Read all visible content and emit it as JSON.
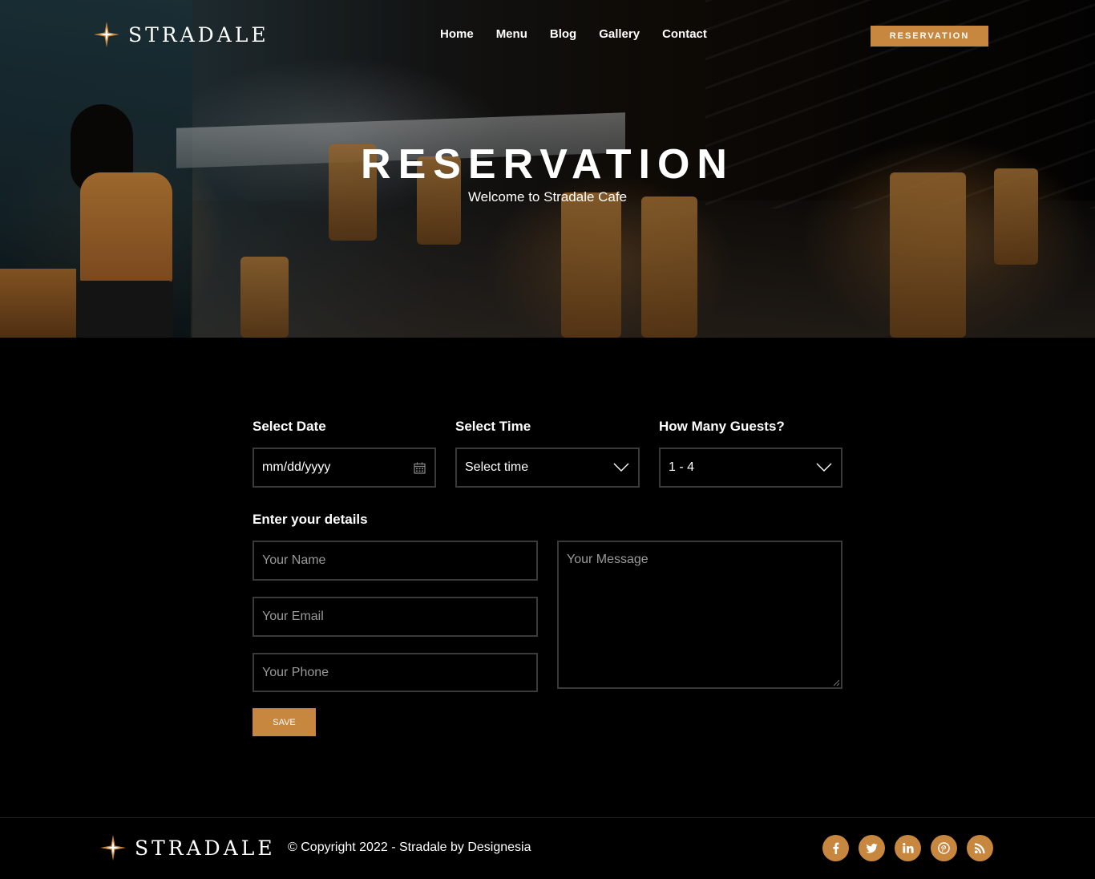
{
  "brand": {
    "name": "STRADALE",
    "logo_icon": "star-icon"
  },
  "nav": {
    "items": [
      {
        "label": "Home"
      },
      {
        "label": "Menu"
      },
      {
        "label": "Blog"
      },
      {
        "label": "Gallery"
      },
      {
        "label": "Contact"
      }
    ],
    "reservation_button": "RESERVATION"
  },
  "hero": {
    "title": "RESERVATION",
    "subtitle": "Welcome to Stradale Cafe"
  },
  "form": {
    "date": {
      "label": "Select Date",
      "value": "mm/dd/yyyy",
      "icon": "calendar-icon"
    },
    "time": {
      "label": "Select Time",
      "value": "Select time",
      "icon": "chevron-down-icon"
    },
    "guests": {
      "label": "How Many Guests?",
      "value": "1 - 4",
      "icon": "chevron-down-icon"
    },
    "details_label": "Enter your details",
    "name_placeholder": "Your Name",
    "email_placeholder": "Your Email",
    "phone_placeholder": "Your Phone",
    "message_placeholder": "Your Message",
    "save_label": "SAVE"
  },
  "footer": {
    "brand": "STRADALE",
    "copyright": "© Copyright 2022 - Stradale by Designesia",
    "socials": [
      "facebook-icon",
      "twitter-icon",
      "linkedin-icon",
      "pinterest-icon",
      "rss-icon"
    ]
  },
  "colors": {
    "accent": "#c8873f",
    "background": "#000000",
    "field_border": "#3a3a3a"
  }
}
